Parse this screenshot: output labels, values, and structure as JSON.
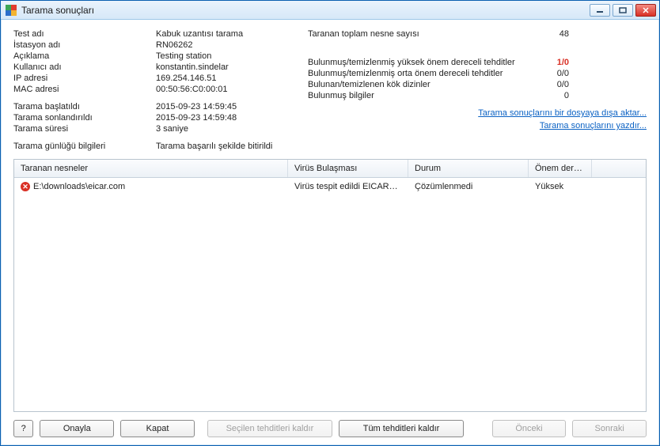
{
  "window": {
    "title": "Tarama sonuçları"
  },
  "info": {
    "labels": {
      "test_name": "Test adı",
      "station_name": "İstasyon adı",
      "description": "Açıklama",
      "username": "Kullanıcı adı",
      "ip": "IP adresi",
      "mac": "MAC adresi",
      "scan_started": "Tarama başlatıldı",
      "scan_ended": "Tarama sonlandırıldı",
      "scan_duration": "Tarama süresi",
      "scan_log": "Tarama günlüğü bilgileri"
    },
    "values": {
      "test_name": "Kabuk uzantısı tarama",
      "station_name": "RN06262",
      "description": "Testing station",
      "username": "konstantin.sindelar",
      "ip": "169.254.146.51",
      "mac": "00:50:56:C0:00:01",
      "scan_started": "2015-09-23 14:59:45",
      "scan_ended": "2015-09-23 14:59:48",
      "scan_duration": "3 saniye",
      "scan_log": "Tarama başarılı şekilde bitirildi"
    }
  },
  "stats": {
    "labels": {
      "total_objects": "Taranan toplam nesne sayısı",
      "high_threats": "Bulunmuş/temizlenmiş yüksek önem dereceli tehditler",
      "med_threats": "Bulunmuş/temizlenmiş orta önem dereceli tehditler",
      "rootkits": "Bulunan/temizlenen kök dizinler",
      "found_info": "Bulunmuş bilgiler"
    },
    "values": {
      "total_objects": "48",
      "high_threats": "1/0",
      "med_threats": "0/0",
      "rootkits": "0/0",
      "found_info": "0"
    }
  },
  "links": {
    "export": "Tarama sonuçlarını bir dosyaya dışa aktar...",
    "print": "Tarama sonuçlarını yazdır..."
  },
  "table": {
    "headers": {
      "objects": "Taranan nesneler",
      "infection": "Virüs Bulaşması",
      "status": "Durum",
      "severity": "Önem derecesi"
    },
    "rows": [
      {
        "object": "E:\\downloads\\eicar.com",
        "infection": "Virüs tespit edildi EICAR_T...",
        "status": "Çözümlenmedi",
        "severity": "Yüksek"
      }
    ]
  },
  "buttons": {
    "help": "?",
    "confirm": "Onayla",
    "close": "Kapat",
    "remove_selected": "Seçilen tehditleri kaldır",
    "remove_all": "Tüm tehditleri kaldır",
    "prev": "Önceki",
    "next": "Sonraki"
  }
}
